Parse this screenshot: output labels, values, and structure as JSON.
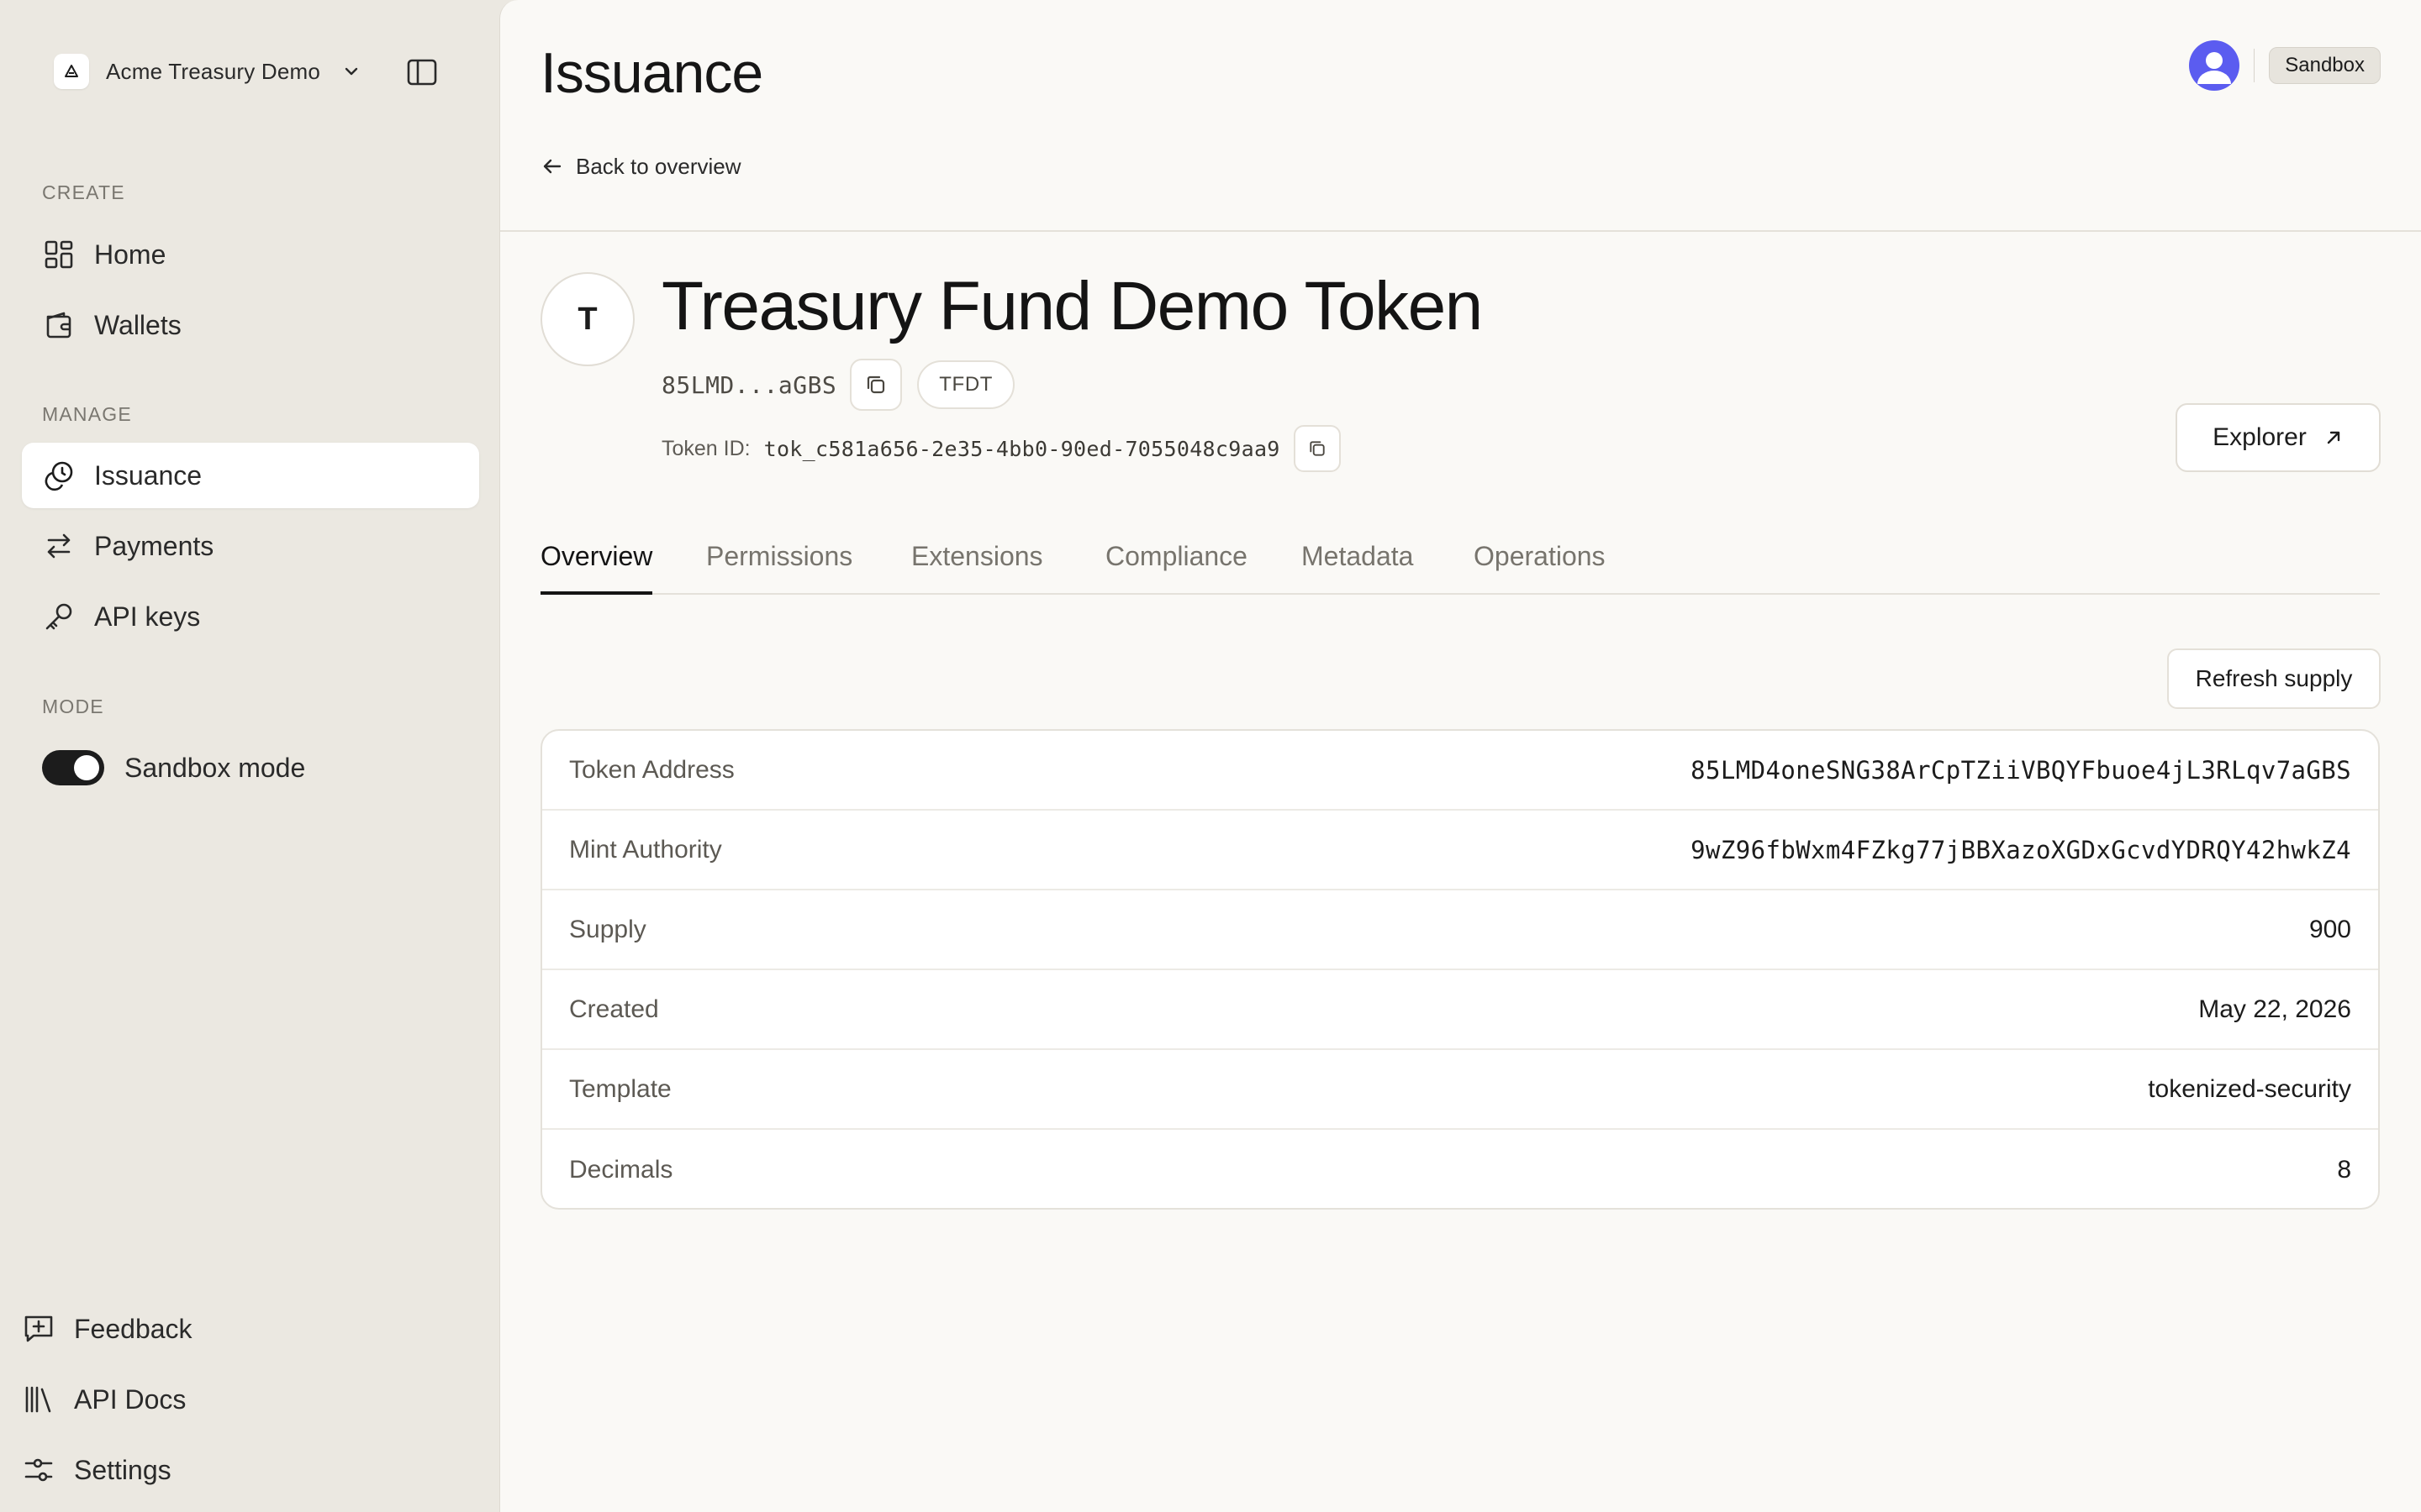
{
  "sidebar": {
    "org_name": "Acme Treasury Demo",
    "sections": {
      "create": "CREATE",
      "manage": "MANAGE",
      "mode": "MODE"
    },
    "items": {
      "home": "Home",
      "wallets": "Wallets",
      "issuance": "Issuance",
      "payments": "Payments",
      "api_keys": "API keys"
    },
    "sandbox_toggle": {
      "label": "Sandbox mode",
      "on": true
    },
    "footer": {
      "feedback": "Feedback",
      "api_docs": "API Docs",
      "settings": "Settings"
    }
  },
  "header": {
    "title": "Issuance",
    "back_label": "Back to overview",
    "environment_badge": "Sandbox"
  },
  "token": {
    "avatar_letter": "T",
    "name": "Treasury Fund Demo Token",
    "short_address": "85LMD...aGBS",
    "symbol": "TFDT",
    "token_id_label": "Token ID:",
    "token_id": "tok_c581a656-2e35-4bb0-90ed-7055048c9aa9",
    "explorer_label": "Explorer"
  },
  "tabs": [
    "Overview",
    "Permissions",
    "Extensions",
    "Compliance",
    "Metadata",
    "Operations"
  ],
  "active_tab": "Overview",
  "refresh_label": "Refresh supply",
  "details": [
    {
      "label": "Token Address",
      "value": "85LMD4oneSNG38ArCpTZiiVBQYFbuoe4jL3RLqv7aGBS"
    },
    {
      "label": "Mint Authority",
      "value": "9wZ96fbWxm4FZkg77jBBXazoXGDxGcvdYDRQY42hwkZ4"
    },
    {
      "label": "Supply",
      "value": "900"
    },
    {
      "label": "Created",
      "value": "May 22, 2026"
    },
    {
      "label": "Template",
      "value": "tokenized-security"
    },
    {
      "label": "Decimals",
      "value": "8"
    }
  ],
  "colors": {
    "sidebar_bg": "#ebe8e1",
    "main_bg": "#faf9f6",
    "avatar_accent": "#5b5cf0",
    "text_primary": "#1c1c1c"
  }
}
